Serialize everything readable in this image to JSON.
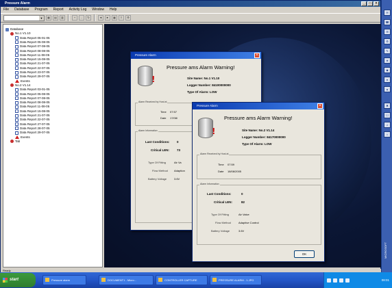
{
  "app": {
    "title": "Pressure Alarm",
    "menu": [
      "File",
      "Database",
      "Program",
      "Report",
      "Activity Log",
      "Window",
      "Help"
    ],
    "status": "Ready"
  },
  "tree": {
    "root": "Database",
    "sites": [
      {
        "label": "No.1 V1.10",
        "reports": [
          "Data Report 05-01-05",
          "Data Report 05-08-05",
          "Data Report 07-08-05",
          "Data Report 08-08-05",
          "Data Report 11-08-05",
          "Data Report 15-08-05",
          "Data Report 21-07-05",
          "Data Report 22-07-05",
          "Data Report 23-07-05",
          "Data Report 29-07-05"
        ],
        "events": "Events"
      },
      {
        "label": "No.2 V1.14",
        "reports": [
          "Data Report 03-01-05",
          "Data Report 05-08-05",
          "Data Report 07-08-05",
          "Data Report 08-08-05",
          "Data Report 11-08-05",
          "Data Report 15-08-05",
          "Data Report 21-07-05",
          "Data Report 22-07-05",
          "Data Report 27-07-05",
          "Data Report 28-07-05",
          "Data Report 29-07-05"
        ],
        "events": "Events"
      }
    ],
    "last": "Tab"
  },
  "dialog_back": {
    "title": "Pressure Alarm",
    "heading": "Pressure ams Alarm Warning!",
    "site_name": "Site Name: No.1 V1.10",
    "logger_number": "Logger Number: 84100000000",
    "type": "Type Of Alarm: LOW",
    "group_received": "Alarm Received by Host at",
    "time_label": "Time",
    "time_value": "07:57",
    "date_label": "Date",
    "date_value": "17/08/",
    "group_info": "Alarm Information",
    "last_cond": "Last Conditions:",
    "last_cond_val": "0",
    "current_val_label": "Critical LEN:",
    "current_val": "73",
    "type_of_fitting": "Type Of Fitting",
    "type_of_fitting_val": "Air Va",
    "flow_method": "Flow Method",
    "flow_method_val": "Adaption",
    "battery": "Battery Voltage",
    "battery_val": "3.6V"
  },
  "dialog_front": {
    "title": "Pressure Alarm",
    "heading": "Pressure ams Alarm Warning!",
    "site_name": "Site Name: No.2 V1.14",
    "logger_number": "Logger Number: 84170000000",
    "type": "Type Of Alarm: LOW",
    "group_received": "Alarm Received by Host at",
    "time_label": "Time",
    "time_value": "07:59",
    "date_label": "Date",
    "date_value": "18/08/2005",
    "group_info": "Alarm Information",
    "last_cond": "Last Conditions:",
    "last_cond_val": "0",
    "current_val_label": "Critical LEN:",
    "current_val": "82",
    "type_of_fitting": "Type Of Fitting",
    "type_of_fitting_val": "Air Valve",
    "flow_method": "Flow Method",
    "flow_method_val": "Adaptive Control",
    "battery": "Battery Voltage",
    "battery_val": "3.6V",
    "ok": "OK"
  },
  "taskbar": {
    "start": "start",
    "tasks": [
      "Pressure alarm",
      "DOCUMENT1 - Micro...",
      "CONTROLLER CAPTURE",
      "PRESSURE ALARM - 1.JPG"
    ],
    "clock": "08:01"
  },
  "rightbar": {
    "label": "MICROSOFT"
  }
}
